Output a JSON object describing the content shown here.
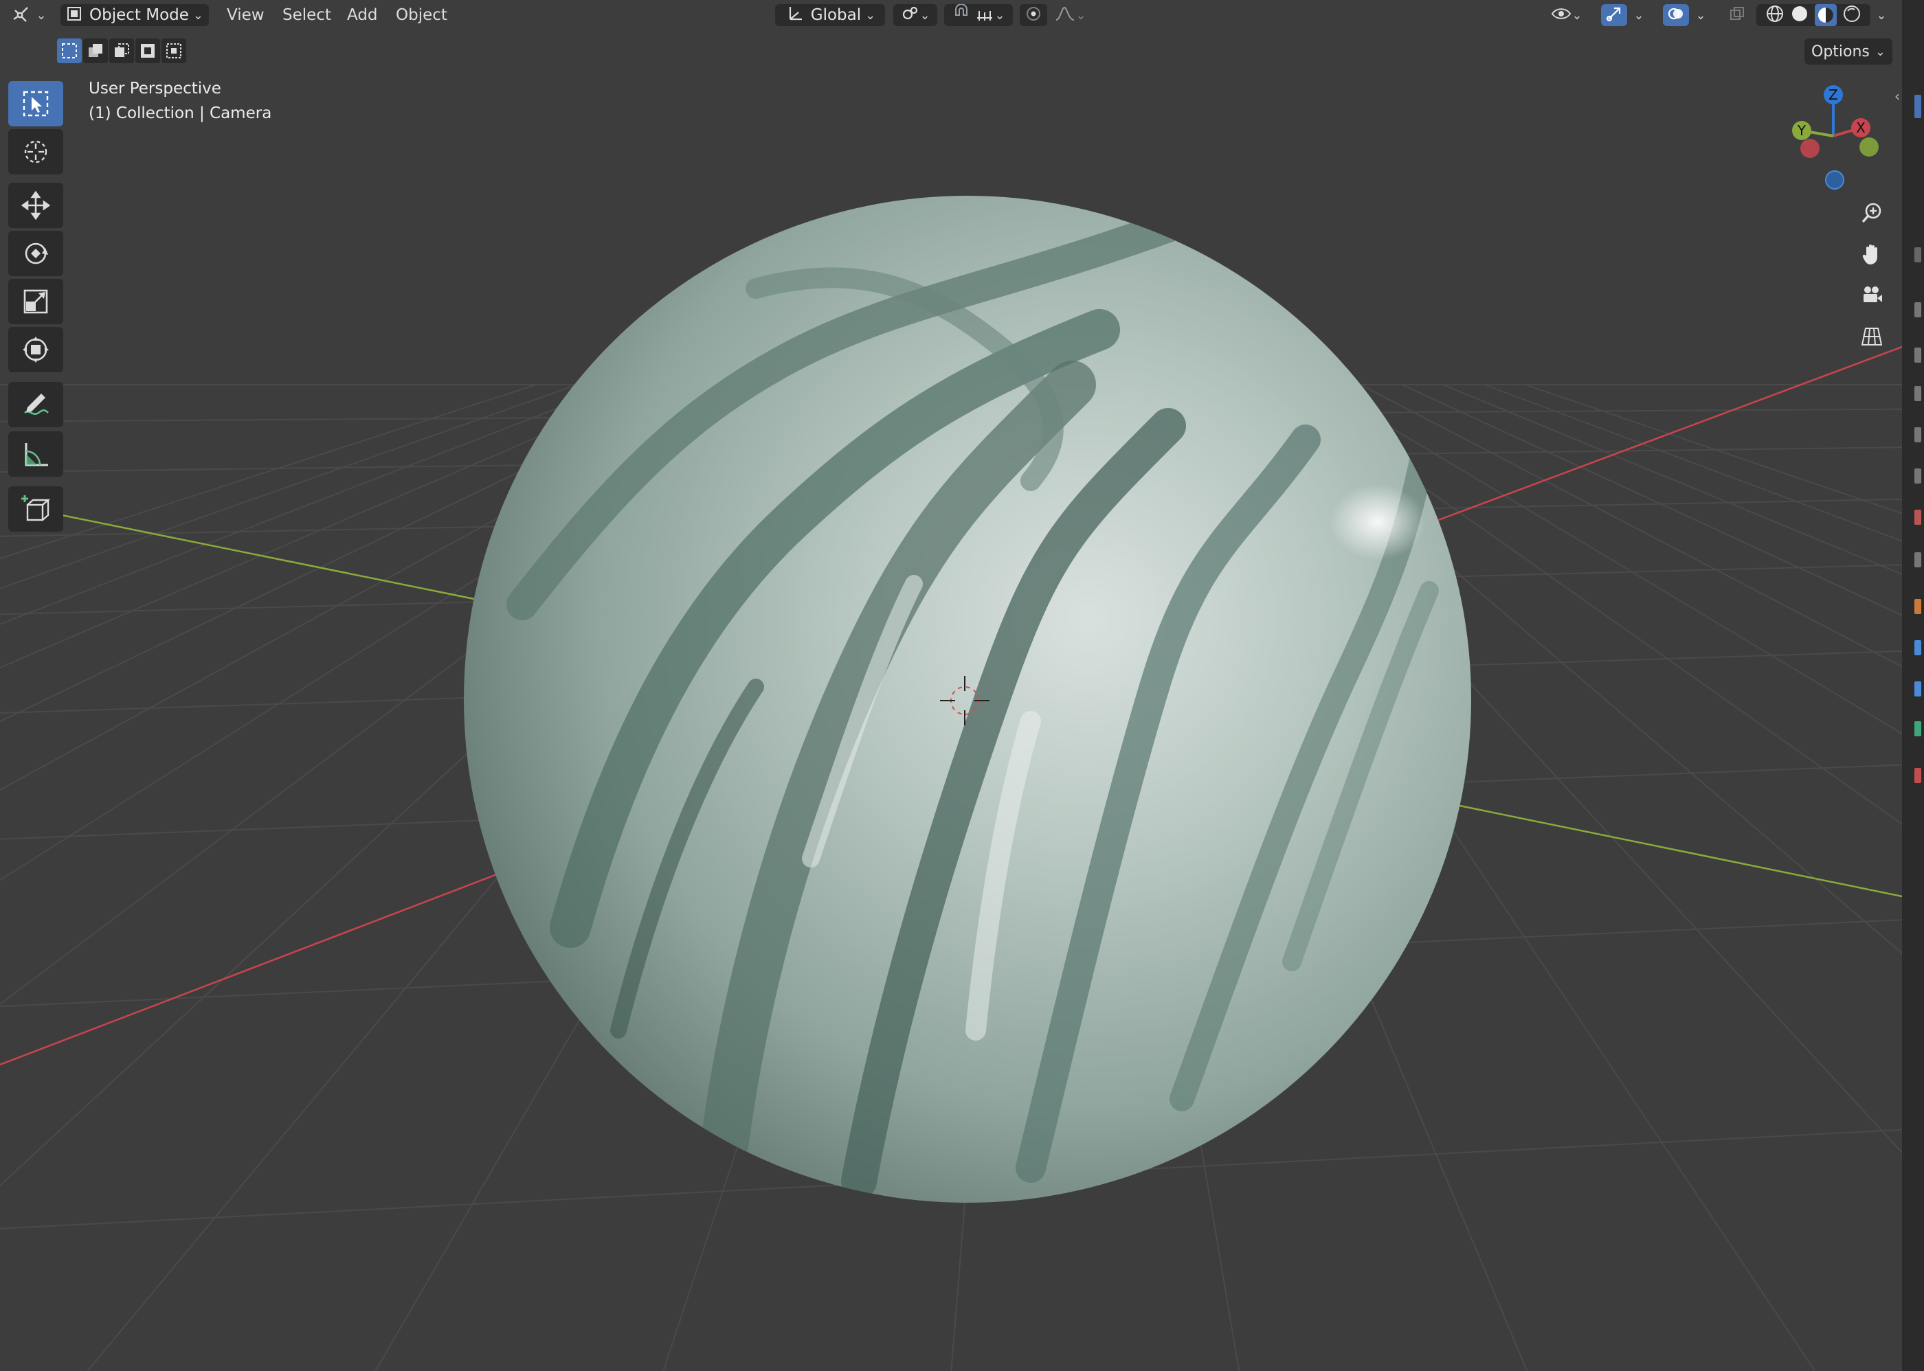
{
  "header": {
    "editor_type_icon": "viewport-editor-icon",
    "mode": "Object Mode",
    "menus": [
      "View",
      "Select",
      "Add",
      "Object"
    ],
    "transform_orientation": "Global"
  },
  "viewport": {
    "view_name": "User Perspective",
    "collection_info": "(1) Collection | Camera",
    "options_label": "Options"
  },
  "gizmo": {
    "x": "X",
    "y": "Y",
    "z": "Z"
  },
  "colors": {
    "accent": "#4772b3",
    "header_bg": "#3d3d3d",
    "button_bg": "#2b2b2b",
    "grid_floor": "#3d3d3d",
    "x_axis": "#c8454f",
    "y_axis": "#8aab3c",
    "z_axis": "#2e77d6"
  },
  "toolbar_tools": [
    "select-box",
    "cursor",
    "move",
    "rotate",
    "scale",
    "transform",
    "annotate",
    "measure",
    "add-cube"
  ]
}
